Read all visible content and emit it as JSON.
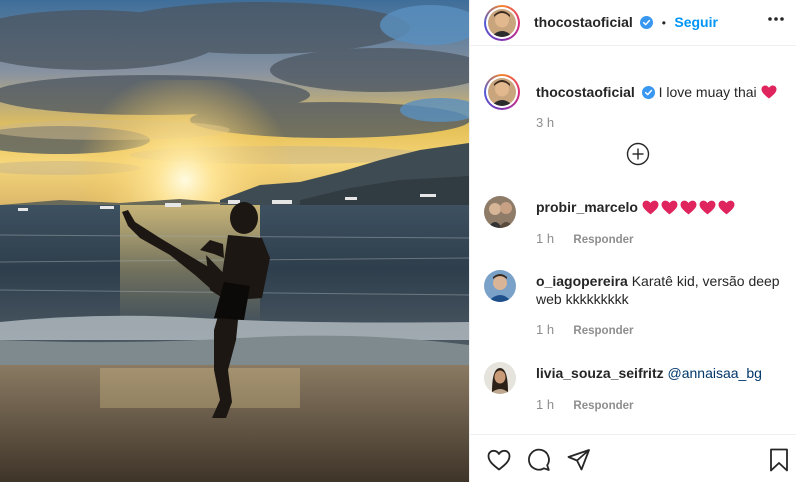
{
  "post": {
    "author": "thocostaoficial",
    "separator": "•",
    "follow_label": "Seguir",
    "caption": "I love muay thai",
    "caption_time": "3 h",
    "icons": {
      "more": "more-options-icon",
      "verified": "verified-badge-icon",
      "load_more": "add-circle-icon",
      "like": "heart-icon",
      "comment": "comment-icon",
      "share": "share-icon",
      "save": "bookmark-icon"
    },
    "colors": {
      "accent": "#0095f6",
      "verified": "#3897f0",
      "heart": "#e0245e"
    }
  },
  "comments": [
    {
      "user": "probir_marcelo",
      "text": "",
      "hearts": 5,
      "time": "1 h",
      "reply": "Responder"
    },
    {
      "user": "o_iagopereira",
      "text": "Karatê kid, versão deep web kkkkkkkkk",
      "time": "1 h",
      "reply": "Responder"
    },
    {
      "user": "livia_souza_seifritz",
      "text": "@annaisaa_bg",
      "time": "1 h",
      "reply": "Responder"
    }
  ]
}
